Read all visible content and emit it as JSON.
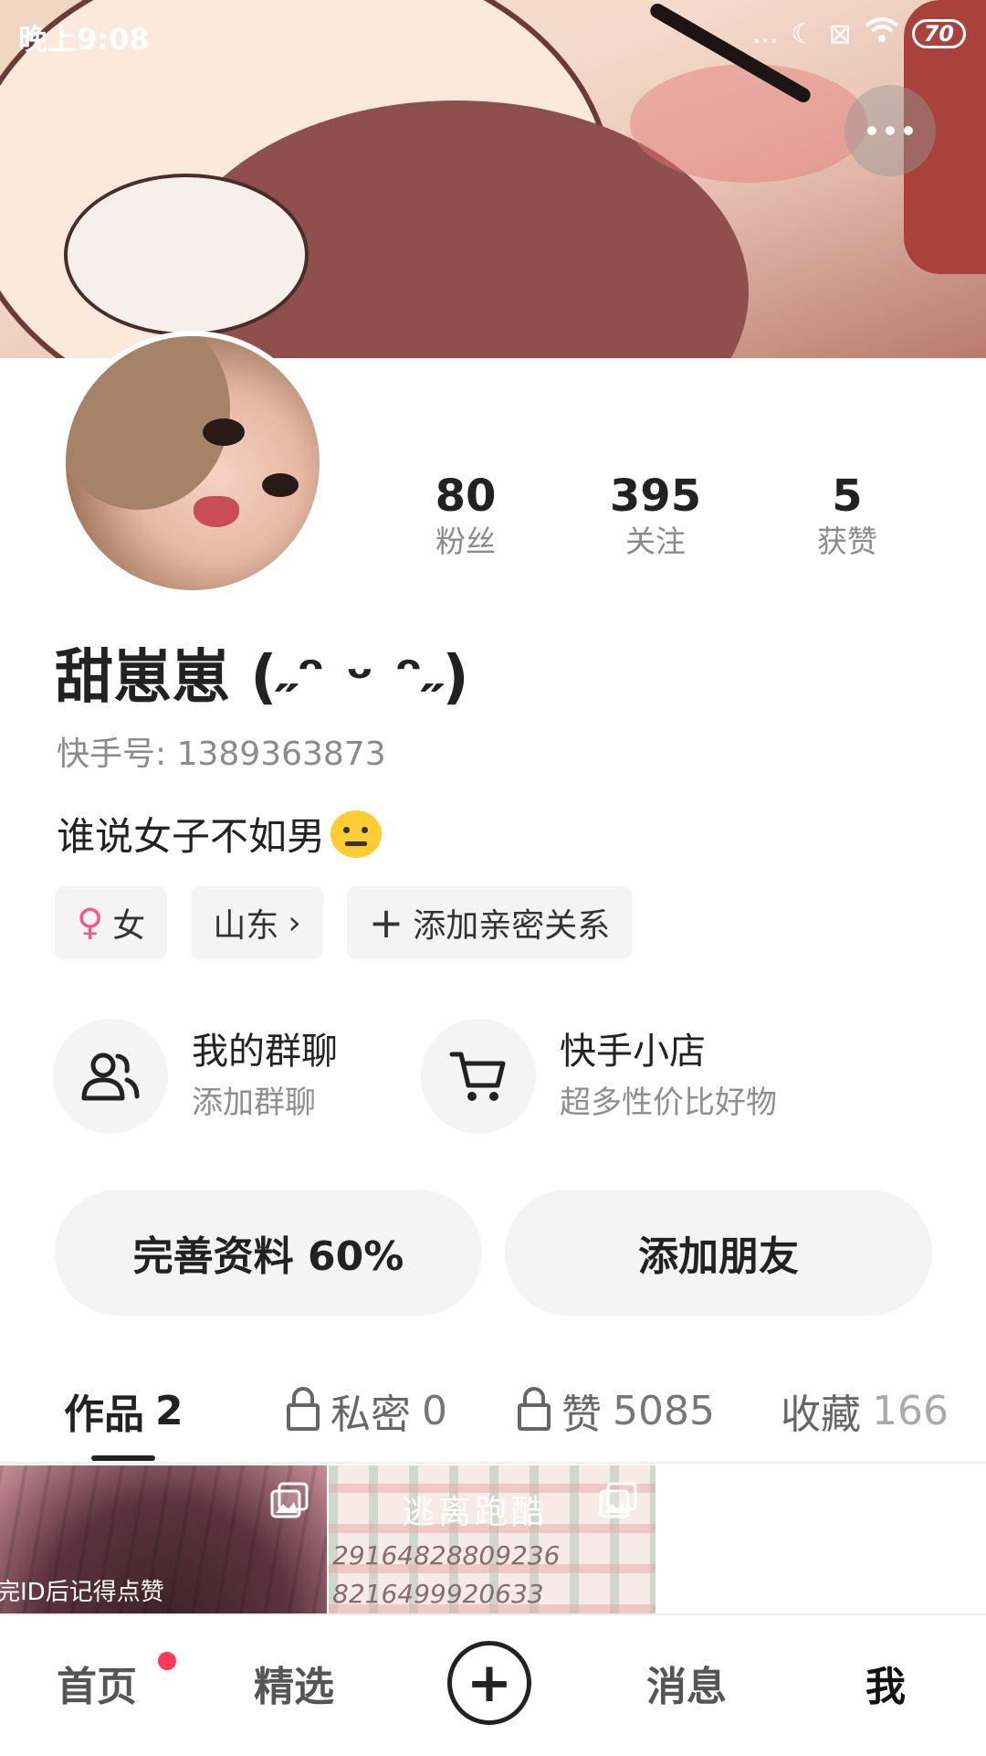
{
  "status_bar": {
    "time": "晚上9:08",
    "battery": "70",
    "dots": "...",
    "moon": "☾",
    "wifi": "wifi",
    "sim": "⊠"
  },
  "profile": {
    "stats": [
      {
        "num": "80",
        "label": "粉丝"
      },
      {
        "num": "395",
        "label": "关注"
      },
      {
        "num": "5",
        "label": "获赞"
      }
    ],
    "nickname": "甜崽崽 (˶ᵔ ᵕ ᵔ˶)",
    "id_text": "快手号: 1389363873",
    "bio": "谁说女子不如男",
    "tags": {
      "gender": "女",
      "gender_icon": "♀",
      "location": "山东",
      "location_chevron": "›",
      "relation": "添加亲密关系",
      "relation_plus": "+"
    }
  },
  "entries": {
    "group_chat": {
      "title": "我的群聊",
      "sub": "添加群聊"
    },
    "shop": {
      "title": "快手小店",
      "sub": "超多性价比好物"
    }
  },
  "buttons": {
    "complete_profile": "完善资料 60%",
    "add_friend": "添加朋友"
  },
  "tabs": [
    {
      "label": "作品",
      "count": "2"
    },
    {
      "label": "私密",
      "count": "0"
    },
    {
      "label": "赞",
      "count": "5085"
    },
    {
      "label": "收藏",
      "count": "166"
    }
  ],
  "thumbs": {
    "first_caption": "完ID后记得点赞",
    "second_title": "逃离跑酷",
    "second_line1": "29164828809236",
    "second_line2": "8216499920633"
  },
  "bottom_nav": {
    "home": "首页",
    "featured": "精选",
    "create": "+",
    "messages": "消息",
    "me": "我"
  },
  "colors": {
    "accent_red": "#ff3b5c",
    "female_pink": "#ef5a8b"
  }
}
